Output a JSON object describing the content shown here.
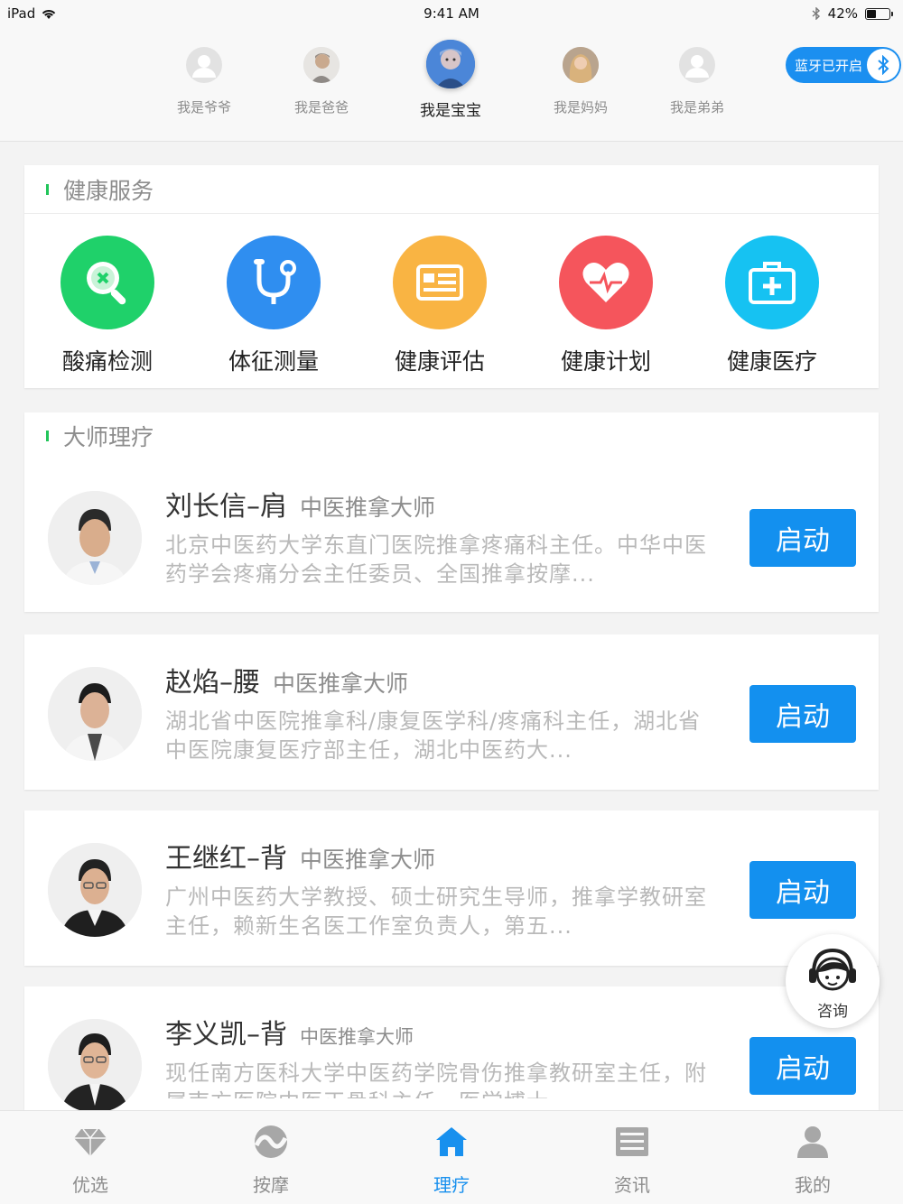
{
  "status_bar": {
    "device": "iPad",
    "time": "9:41 AM",
    "battery": "42%",
    "battery_level": 0.42,
    "icons": [
      "wifi-icon",
      "bluetooth-icon",
      "battery-icon"
    ]
  },
  "family": {
    "members": [
      {
        "name": "我是爷爷",
        "active": false
      },
      {
        "name": "我是爸爸",
        "active": false
      },
      {
        "name": "我是宝宝",
        "active": true
      },
      {
        "name": "我是妈妈",
        "active": false
      },
      {
        "name": "我是弟弟",
        "active": false
      }
    ],
    "bluetooth_label": "蓝牙已开启"
  },
  "health_services": {
    "title": "健康服务",
    "items": [
      {
        "label": "酸痛检测",
        "color": "#1fd16a",
        "icon": "magnifier-icon"
      },
      {
        "label": "体征测量",
        "color": "#2f8ef0",
        "icon": "stethoscope-icon"
      },
      {
        "label": "健康评估",
        "color": "#f9b443",
        "icon": "id-card-icon"
      },
      {
        "label": "健康计划",
        "color": "#f5555c",
        "icon": "heart-pulse-icon"
      },
      {
        "label": "健康医疗",
        "color": "#16c2f2",
        "icon": "medical-kit-icon"
      }
    ]
  },
  "master_therapy": {
    "title": "大师理疗",
    "experts": [
      {
        "name": "刘长信–肩",
        "role": "中医推拿大师",
        "desc": "北京中医药大学东直门医院推拿疼痛科主任。中华中医药学会疼痛分会主任委员、全国推拿按摩...",
        "button": "启动"
      },
      {
        "name": "赵焰–腰",
        "role": "中医推拿大师",
        "desc": "湖北省中医院推拿科/康复医学科/疼痛科主任，湖北省中医院康复医疗部主任，湖北中医药大...",
        "button": "启动"
      },
      {
        "name": "王继红–背",
        "role": "中医推拿大师",
        "desc": "广州中医药大学教授、硕士研究生导师，推拿学教研室主任，赖新生名医工作室负责人，第五...",
        "button": "启动"
      },
      {
        "name": "李义凯–背",
        "role": "中医推拿大师",
        "desc": "现任南方医科大学中医药学院骨伤推拿教研室主任，附属南方医院中医正骨科主任，医学博士...",
        "button": "启动"
      }
    ]
  },
  "consult": {
    "label": "咨询"
  },
  "tab_bar": {
    "tabs": [
      {
        "label": "优选",
        "icon": "diamond-icon",
        "active": false
      },
      {
        "label": "按摩",
        "icon": "wave-ball-icon",
        "active": false
      },
      {
        "label": "理疗",
        "icon": "home-icon",
        "active": true
      },
      {
        "label": "资讯",
        "icon": "news-list-icon",
        "active": false
      },
      {
        "label": "我的",
        "icon": "person-icon",
        "active": false
      }
    ]
  },
  "colors": {
    "accent": "#1390ef",
    "green_mark": "#22c55a",
    "active_tab": "#1890ee"
  }
}
